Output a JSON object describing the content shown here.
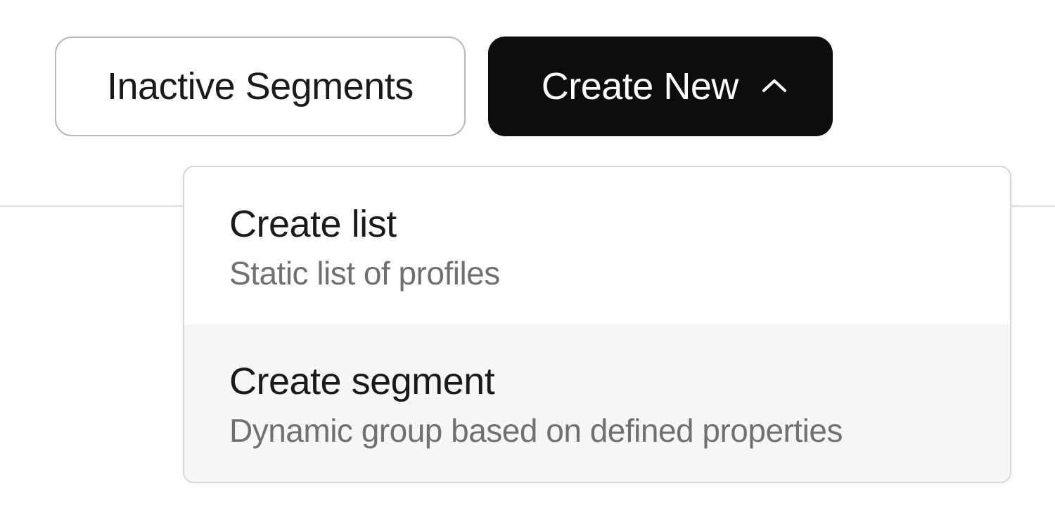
{
  "toolbar": {
    "inactive_segments_label": "Inactive Segments",
    "create_new_label": "Create New"
  },
  "dropdown": {
    "items": [
      {
        "title": "Create list",
        "description": "Static list of profiles"
      },
      {
        "title": "Create segment",
        "description": "Dynamic group based on defined properties"
      }
    ]
  }
}
